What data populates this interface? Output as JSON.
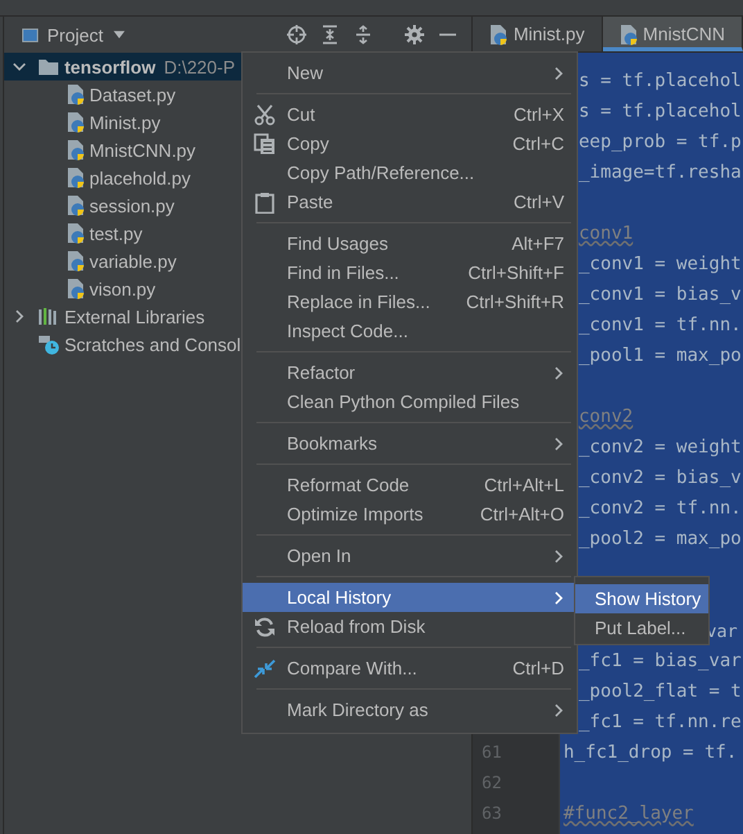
{
  "project_panel": {
    "title": "Project",
    "tree": [
      {
        "kind": "folder",
        "label": "tensorflow",
        "path": "D:\\220-P",
        "expanded": true,
        "selected": true,
        "children": [
          {
            "kind": "file",
            "label": "Dataset.py"
          },
          {
            "kind": "file",
            "label": "Minist.py"
          },
          {
            "kind": "file",
            "label": "MnistCNN.py"
          },
          {
            "kind": "file",
            "label": "placehold.py"
          },
          {
            "kind": "file",
            "label": "session.py"
          },
          {
            "kind": "file",
            "label": "test.py"
          },
          {
            "kind": "file",
            "label": "variable.py"
          },
          {
            "kind": "file",
            "label": "vison.py"
          }
        ]
      },
      {
        "kind": "library",
        "label": "External Libraries",
        "expanded": false,
        "selected": false
      },
      {
        "kind": "scratches",
        "label": "Scratches and Consol",
        "selected": false
      }
    ]
  },
  "editor_tabs": [
    {
      "label": "Minist.py",
      "selected": false
    },
    {
      "label": "MnistCNN",
      "selected": true
    }
  ],
  "code_lines": [
    {
      "kind": "code",
      "clipped": true,
      "text": "s = tf.placehol"
    },
    {
      "kind": "code",
      "clipped": true,
      "text": "s = tf.placehol"
    },
    {
      "kind": "code",
      "clipped": true,
      "text": "eep_prob = tf.p"
    },
    {
      "kind": "code",
      "clipped": true,
      "text": "_image=tf.resha"
    },
    {
      "kind": "blank"
    },
    {
      "kind": "comment",
      "clipped": true,
      "text": "conv1"
    },
    {
      "kind": "code",
      "clipped": true,
      "text": "_conv1 = weight"
    },
    {
      "kind": "code",
      "clipped": true,
      "text": "_conv1 = bias_v"
    },
    {
      "kind": "code",
      "clipped": true,
      "text": "_conv1 = tf.nn."
    },
    {
      "kind": "code",
      "clipped": true,
      "text": "_pool1 = max_po"
    },
    {
      "kind": "blank"
    },
    {
      "kind": "comment",
      "clipped": true,
      "text": "conv2"
    },
    {
      "kind": "code",
      "clipped": true,
      "text": "_conv2 = weight"
    },
    {
      "kind": "code",
      "clipped": true,
      "text": "_conv2 = bias_v"
    },
    {
      "kind": "code",
      "clipped": true,
      "text": "_conv2 = tf.nn."
    },
    {
      "kind": "code",
      "clipped": true,
      "text": "_pool2 = max_po"
    },
    {
      "kind": "blank"
    },
    {
      "kind": "blank"
    },
    {
      "kind": "tail",
      "text": "var"
    },
    {
      "kind": "code",
      "clipped": true,
      "text": "_fc1 = bias_var"
    },
    {
      "kind": "code",
      "clipped": true,
      "text": "_pool2_flat = t"
    },
    {
      "kind": "code",
      "clipped": true,
      "text": "_fc1 = tf.nn.re"
    },
    {
      "kind": "code",
      "clipped": false,
      "number": "61",
      "text": "h_fc1_drop = tf."
    },
    {
      "kind": "blank",
      "number": "62"
    },
    {
      "kind": "comment",
      "clipped": false,
      "number": "63",
      "text": "#func2_layer"
    }
  ],
  "context_menu": [
    {
      "kind": "item",
      "label": "New",
      "submenu": true,
      "selected": false
    },
    {
      "kind": "separator"
    },
    {
      "kind": "cut",
      "label": "Cut",
      "shortcut": "Ctrl+X",
      "selected": false
    },
    {
      "kind": "copy",
      "label": "Copy",
      "shortcut": "Ctrl+C",
      "selected": false
    },
    {
      "kind": "item",
      "label": "Copy Path/Reference...",
      "selected": false
    },
    {
      "kind": "paste",
      "label": "Paste",
      "shortcut": "Ctrl+V",
      "selected": false
    },
    {
      "kind": "separator"
    },
    {
      "kind": "item",
      "label": "Find Usages",
      "shortcut": "Alt+F7",
      "selected": false
    },
    {
      "kind": "item",
      "label": "Find in Files...",
      "shortcut": "Ctrl+Shift+F",
      "selected": false
    },
    {
      "kind": "item",
      "label": "Replace in Files...",
      "shortcut": "Ctrl+Shift+R",
      "selected": false
    },
    {
      "kind": "item",
      "label": "Inspect Code...",
      "selected": false
    },
    {
      "kind": "separator"
    },
    {
      "kind": "item",
      "label": "Refactor",
      "submenu": true,
      "selected": false
    },
    {
      "kind": "item",
      "label": "Clean Python Compiled Files",
      "selected": false
    },
    {
      "kind": "separator"
    },
    {
      "kind": "item",
      "label": "Bookmarks",
      "submenu": true,
      "selected": false
    },
    {
      "kind": "separator"
    },
    {
      "kind": "item",
      "label": "Reformat Code",
      "shortcut": "Ctrl+Alt+L",
      "selected": false
    },
    {
      "kind": "item",
      "label": "Optimize Imports",
      "shortcut": "Ctrl+Alt+O",
      "selected": false
    },
    {
      "kind": "separator"
    },
    {
      "kind": "item",
      "label": "Open In",
      "submenu": true,
      "selected": false
    },
    {
      "kind": "separator"
    },
    {
      "kind": "item",
      "label": "Local History",
      "submenu": true,
      "selected": true
    },
    {
      "kind": "reload",
      "label": "Reload from Disk",
      "selected": false
    },
    {
      "kind": "separator"
    },
    {
      "kind": "compare",
      "label": "Compare With...",
      "shortcut": "Ctrl+D",
      "selected": false
    },
    {
      "kind": "separator"
    },
    {
      "kind": "item",
      "label": "Mark Directory as",
      "submenu": true,
      "selected": false
    }
  ],
  "submenu": [
    {
      "label": "Show History",
      "selected": true
    },
    {
      "label": "Put Label...",
      "selected": false
    }
  ]
}
